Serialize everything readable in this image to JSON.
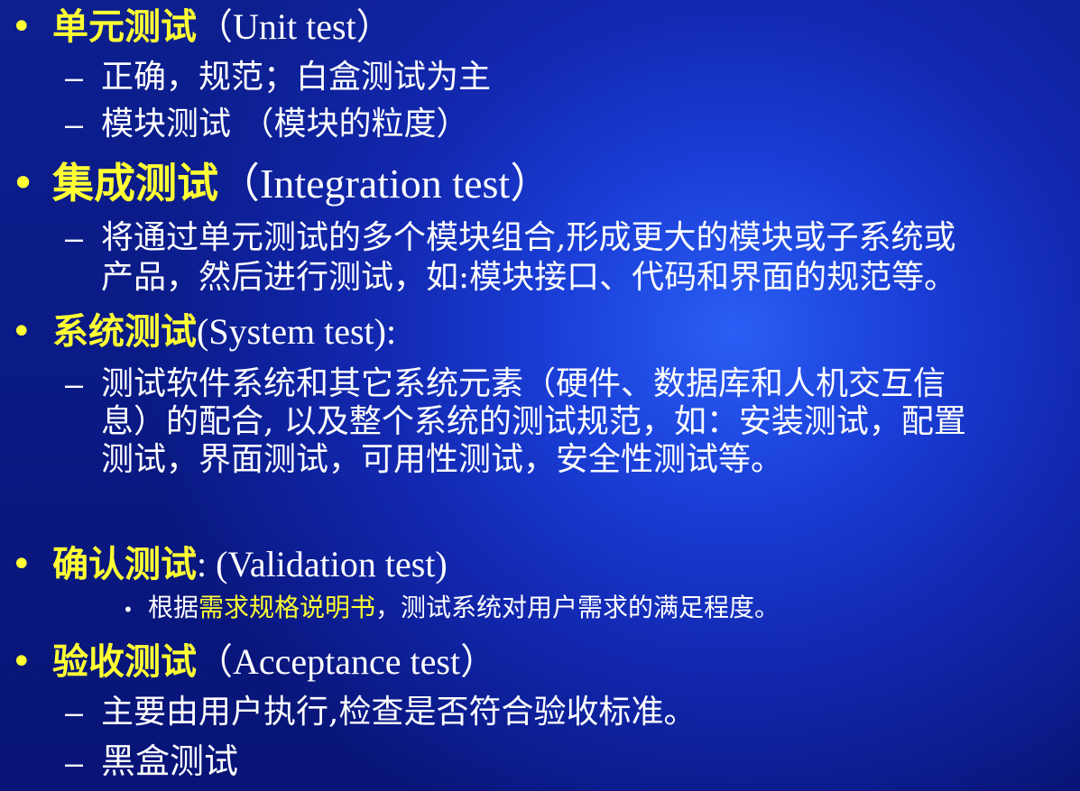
{
  "bullet_glyph": "•",
  "dash_glyph": "–",
  "sub_bullet_glyph": "•",
  "colors": {
    "keyword": "#ffff33",
    "text": "#ffffff",
    "background": "#0d1f8f"
  },
  "items": [
    {
      "keyword": "单元测试",
      "english": "（Unit test）",
      "subs": [
        "正确，规范；白盒测试为主",
        "模块测试 （模块的粒度）"
      ]
    },
    {
      "keyword": "集成测试",
      "english": "（Integration test）",
      "subs": [
        "将通过单元测试的多个模块组合,形成更大的模块或子系统或",
        "产品，然后进行测试，如:模块接口、代码和界面的规范等。"
      ]
    },
    {
      "keyword": "系统测试",
      "english": "(System test):",
      "subs": [
        "测试软件系统和其它系统元素（硬件、数据库和人机交互信",
        "息）的配合, 以及整个系统的测试规范，如：安装测试，配置",
        "测试，界面测试，可用性测试，安全性测试等。"
      ]
    },
    {
      "keyword": "确认测试",
      "english": ": (Validation test)",
      "sub_prefix": "根据",
      "sub_highlight": "需求规格说明书",
      "sub_suffix": "，测试系统对用户需求的满足程度。"
    },
    {
      "keyword": "验收测试",
      "english": "（Acceptance test）",
      "subs": [
        "主要由用户执行,检查是否符合验收标准。",
        "黑盒测试"
      ]
    }
  ]
}
